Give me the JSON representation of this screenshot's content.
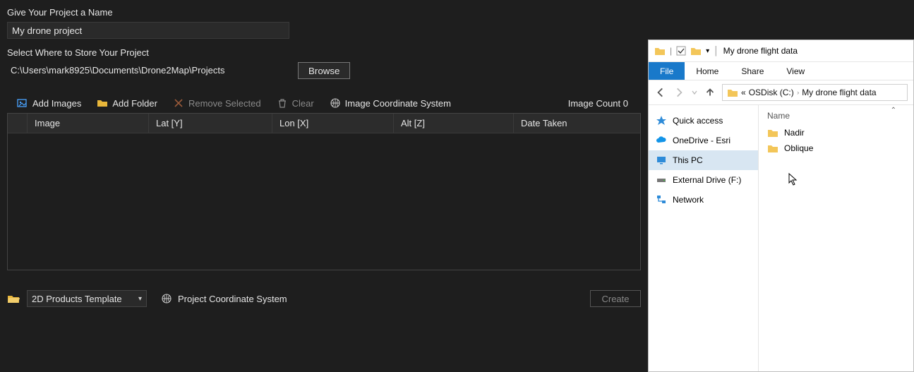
{
  "app": {
    "labels": {
      "project_name": "Give Your Project a Name",
      "store_where": "Select Where to Store Your Project"
    },
    "project_name_value": "My drone project",
    "store_path": "C:\\Users\\mark8925\\Documents\\Drone2Map\\Projects",
    "browse_label": "Browse",
    "toolbar": {
      "add_images": "Add Images",
      "add_folder": "Add Folder",
      "remove_selected": "Remove Selected",
      "clear": "Clear",
      "img_coord_system": "Image Coordinate System"
    },
    "image_count_prefix": "Image Count",
    "image_count": "0",
    "columns": {
      "image": "Image",
      "lat": "Lat [Y]",
      "lon": "Lon [X]",
      "alt": "Alt [Z]",
      "date": "Date Taken"
    },
    "template_selected": "2D Products Template",
    "project_coord_system": "Project Coordinate System",
    "create_label": "Create"
  },
  "explorer": {
    "title": "My drone flight data",
    "ribbon": {
      "file": "File",
      "home": "Home",
      "share": "Share",
      "view": "View"
    },
    "breadcrumb": {
      "prefix": "«",
      "segs": [
        "OSDisk (C:)",
        "My drone flight data"
      ]
    },
    "nav": {
      "quick": "Quick access",
      "onedrive": "OneDrive - Esri",
      "thispc": "This PC",
      "external": "External Drive (F:)",
      "network": "Network"
    },
    "column_header": "Name",
    "items": [
      "Nadir",
      "Oblique"
    ]
  }
}
